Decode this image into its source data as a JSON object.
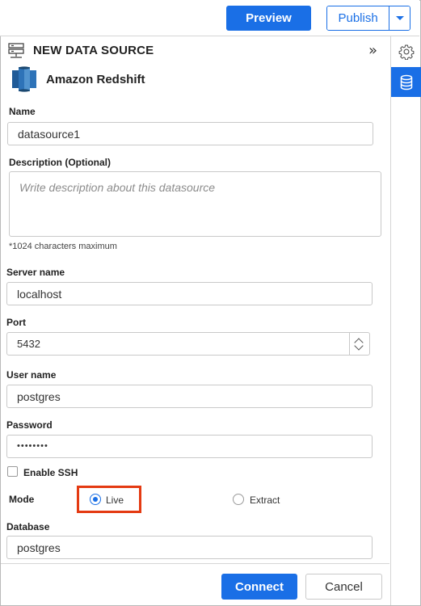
{
  "toolbar": {
    "preview_label": "Preview",
    "publish_label": "Publish",
    "accent_color": "#1a6fe6"
  },
  "rail": {
    "icons": [
      "gear-icon",
      "database-icon"
    ],
    "active": "database-icon"
  },
  "panel": {
    "title": "NEW DATA SOURCE",
    "source_name": "Amazon Redshift"
  },
  "form": {
    "name_label": "Name",
    "name_value": "datasource1",
    "description_label": "Description (Optional)",
    "description_placeholder": "Write description about this datasource",
    "description_hint": "*1024 characters maximum",
    "server_label": "Server name",
    "server_value": "localhost",
    "port_label": "Port",
    "port_value": "5432",
    "user_label": "User name",
    "user_value": "postgres",
    "password_label": "Password",
    "password_value": "••••••••",
    "ssh_label": "Enable SSH",
    "ssh_checked": false,
    "mode_label": "Mode",
    "mode_options": [
      "Live",
      "Extract"
    ],
    "mode_selected": "Live",
    "database_label": "Database",
    "database_value": "postgres"
  },
  "footer": {
    "connect_label": "Connect",
    "cancel_label": "Cancel"
  },
  "highlight_color": "#e43a12"
}
